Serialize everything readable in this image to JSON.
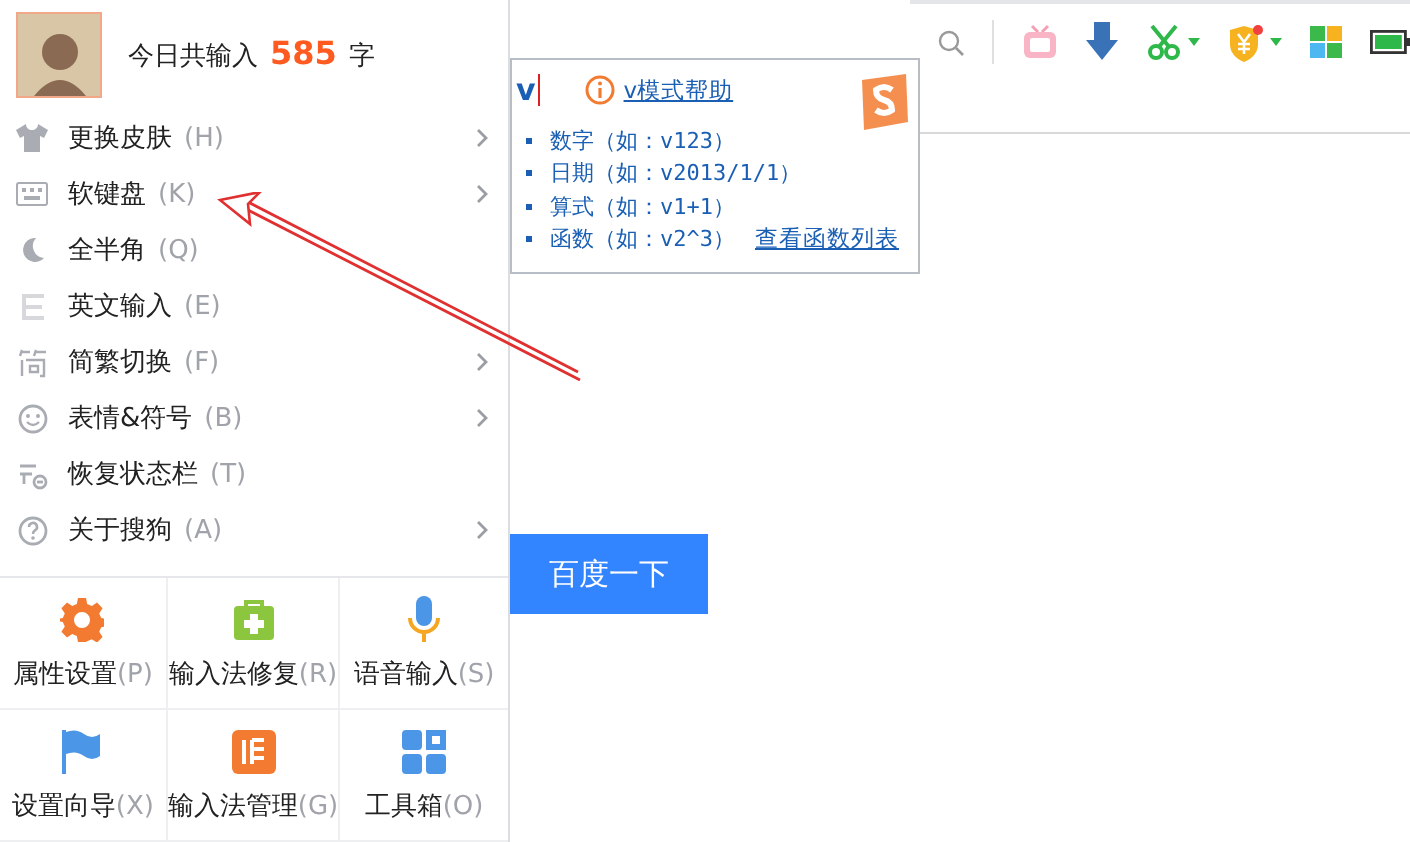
{
  "header": {
    "greeting": "今日共输入",
    "count": "585",
    "unit": "字"
  },
  "menu_items": [
    {
      "label": "更换皮肤",
      "shortcut": "(H)",
      "has_submenu": true
    },
    {
      "label": "软键盘",
      "shortcut": "(K)",
      "has_submenu": true
    },
    {
      "label": "全半角",
      "shortcut": "(Q)",
      "has_submenu": false
    },
    {
      "label": "英文输入",
      "shortcut": "(E)",
      "has_submenu": false
    },
    {
      "label": "简繁切换",
      "shortcut": "(F)",
      "has_submenu": true
    },
    {
      "label": "表情&符号",
      "shortcut": "(B)",
      "has_submenu": true
    },
    {
      "label": "恢复状态栏",
      "shortcut": "(T)",
      "has_submenu": false
    },
    {
      "label": "关于搜狗",
      "shortcut": "(A)",
      "has_submenu": true
    }
  ],
  "tools": [
    {
      "label": "属性设置",
      "shortcut": "(P)"
    },
    {
      "label": "输入法修复",
      "shortcut": "(R)"
    },
    {
      "label": "语音输入",
      "shortcut": "(S)"
    },
    {
      "label": "设置向导",
      "shortcut": "(X)"
    },
    {
      "label": "输入法管理",
      "shortcut": "(G)"
    },
    {
      "label": "工具箱",
      "shortcut": "(O)"
    }
  ],
  "ime_popup": {
    "input": "v",
    "help_link": "v模式帮助",
    "hints": [
      {
        "text": "数字（如：v123）"
      },
      {
        "text": "日期（如：v2013/1/1）"
      },
      {
        "text": "算式（如：v1+1）"
      },
      {
        "text": "函数（如：v2^3）"
      }
    ],
    "function_list_link": "查看函数列表"
  },
  "search_button": "百度一下"
}
